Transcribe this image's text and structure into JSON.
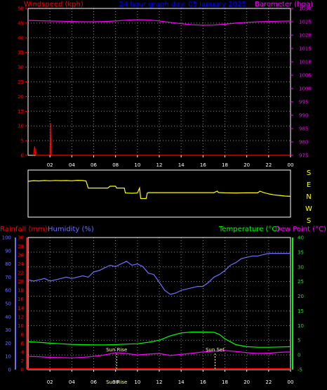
{
  "header": {
    "left_label": "Windspeed (kph)",
    "center_label": "24 hour graph day: 05 January 2025",
    "right_label": "Barometer (hpa)"
  },
  "colors": {
    "wind": "#ff0000",
    "barometer": "#ff00ff",
    "header_center": "#0000ff",
    "direction": "#ffff00",
    "rain": "#ff0000",
    "humidity": "#6f6fff",
    "temperature": "#00ff00",
    "dewpoint": "#ff00ff",
    "grid": "#8a8a8a",
    "axis_text": "#ffffff",
    "sun": "#ffffaa"
  },
  "time_ticks": [
    "02",
    "04",
    "06",
    "08",
    "10",
    "12",
    "14",
    "16",
    "18",
    "20",
    "22",
    "00"
  ],
  "direction_labels": [
    "S",
    "E",
    "N",
    "W",
    "S"
  ],
  "bottom_header": {
    "rainfall_label": "Rainfall (mm)",
    "humidity_label": "Humidity (%)",
    "temperature_label": "Temperature (°C)",
    "dewpoint_label": "Dew Point (°C)"
  },
  "sun_events": {
    "sunrise_label": "Sun Rise",
    "sunset_label": "Sun Set",
    "sun_bottom_label": "Sun Rise",
    "sunrise_hour": 8.1,
    "sunset_hour": 17.1
  },
  "chart_data": [
    {
      "type": "line",
      "title": "24 hour graph day: 05 January 2025",
      "x_range_hours": [
        0,
        24
      ],
      "left_axis": {
        "label": "Windspeed (kph)",
        "range": [
          0,
          50
        ],
        "ticks": [
          0,
          5,
          10,
          15,
          20,
          25,
          30,
          35,
          40,
          45,
          50
        ]
      },
      "right_axis": {
        "label": "Barometer (hpa)",
        "range": [
          975,
          1030
        ],
        "ticks": [
          975,
          980,
          985,
          990,
          995,
          1000,
          1005,
          1010,
          1015,
          1020,
          1025,
          1030
        ]
      },
      "grid": true,
      "series": [
        {
          "name": "Windspeed",
          "axis": "left",
          "x": [
            0.5,
            0.6,
            0.7,
            2.0,
            2.05,
            2.1,
            3.0,
            12.0,
            24.0
          ],
          "y": [
            0,
            3,
            0,
            0,
            11,
            0,
            0,
            0,
            0
          ]
        },
        {
          "name": "Barometer",
          "axis": "right",
          "x": [
            0,
            1,
            2,
            3,
            4,
            5,
            6,
            7,
            8,
            9,
            10,
            11,
            12,
            13,
            14,
            15,
            16,
            17,
            18,
            19,
            20,
            21,
            22,
            23,
            24
          ],
          "y": [
            1025.5,
            1025.4,
            1025.3,
            1025.2,
            1025.1,
            1025.0,
            1025.0,
            1025.1,
            1025.3,
            1025.6,
            1025.8,
            1025.7,
            1025.3,
            1024.8,
            1024.3,
            1023.9,
            1023.7,
            1023.8,
            1024.1,
            1024.5,
            1024.8,
            1025.0,
            1025.1,
            1025.2,
            1025.3
          ]
        }
      ]
    },
    {
      "type": "line",
      "x_range_hours": [
        0,
        24
      ],
      "direction_axis": [
        "S",
        "E",
        "N",
        "W",
        "S"
      ],
      "series": [
        {
          "name": "Wind direction",
          "unit": "degrees",
          "x": [
            0,
            0.5,
            1,
            1.5,
            2,
            2.5,
            3,
            3.5,
            4,
            4.5,
            5,
            5.3,
            5.5,
            6,
            7,
            7.3,
            7.5,
            8.0,
            8.1,
            8.5,
            8.8,
            8.9,
            9.5,
            10,
            10.2,
            10.3,
            10.8,
            10.9,
            11,
            12,
            13,
            14,
            15,
            16,
            17,
            17.3,
            17.4,
            17.5,
            17.6,
            18,
            19,
            20,
            21,
            21.2,
            21.5,
            22,
            22.5,
            23,
            23.5,
            24
          ],
          "y": [
            280,
            285,
            283,
            286,
            284,
            287,
            285,
            286,
            284,
            288,
            286,
            283,
            225,
            225,
            225,
            225,
            240,
            240,
            225,
            225,
            225,
            185,
            183,
            185,
            225,
            140,
            140,
            185,
            188,
            188,
            188,
            188,
            188,
            188,
            188,
            200,
            190,
            188,
            188,
            186,
            185,
            187,
            186,
            200,
            190,
            178,
            170,
            165,
            160,
            158
          ]
        }
      ]
    },
    {
      "type": "line",
      "x_range_hours": [
        0,
        24
      ],
      "left_axes": [
        {
          "label": "Rainfall (mm)",
          "range": [
            0,
            30
          ],
          "ticks": [
            0,
            2,
            4,
            6,
            8,
            10,
            12,
            14,
            16,
            18,
            20,
            22,
            24,
            26,
            28,
            30
          ]
        },
        {
          "label": "Humidity (%)",
          "range": [
            0,
            100
          ],
          "ticks": [
            0,
            10,
            20,
            30,
            40,
            50,
            60,
            70,
            80,
            90,
            100
          ]
        }
      ],
      "right_axis": {
        "label": "Temperature (°C) / Dew Point (°C)",
        "range": [
          -5,
          40
        ],
        "ticks": [
          -5,
          0,
          5,
          10,
          15,
          20,
          25,
          30,
          35,
          40
        ]
      },
      "grid": true,
      "series": [
        {
          "name": "Rainfall",
          "axis": "rain",
          "x": [
            0,
            24
          ],
          "y": [
            0,
            0
          ]
        },
        {
          "name": "Humidity",
          "axis": "humidity",
          "x": [
            0,
            0.5,
            1,
            1.5,
            2,
            2.5,
            3,
            3.5,
            4,
            4.5,
            5,
            5.5,
            6,
            6.5,
            7,
            7.5,
            8,
            8.5,
            9,
            9.5,
            10,
            10.5,
            11,
            11.5,
            12,
            12.5,
            13,
            13.5,
            14,
            14.5,
            15,
            15.5,
            16,
            16.5,
            17,
            17.5,
            18,
            18.5,
            19,
            19.5,
            20,
            20.5,
            21,
            21.5,
            22,
            22.5,
            23,
            23.5,
            24
          ],
          "y": [
            68,
            67,
            68,
            69,
            67,
            68,
            69,
            70,
            69,
            70,
            71,
            70,
            74,
            75,
            77,
            79,
            78,
            80,
            82,
            79,
            80,
            78,
            73,
            72,
            66,
            60,
            57,
            58,
            60,
            61,
            62,
            63,
            63,
            66,
            70,
            72,
            75,
            79,
            81,
            84,
            85,
            86,
            86,
            87,
            88,
            88,
            88,
            88,
            88
          ]
        },
        {
          "name": "Temperature",
          "axis": "temp",
          "x": [
            0,
            1,
            2,
            3,
            4,
            5,
            6,
            7,
            8,
            9,
            10,
            11,
            12,
            13,
            14,
            15,
            16,
            17,
            17.5,
            18,
            18.5,
            19,
            20,
            21,
            22,
            23,
            24
          ],
          "y": [
            4.5,
            4.3,
            4.0,
            3.8,
            3.6,
            3.5,
            3.4,
            3.4,
            3.5,
            3.7,
            3.8,
            4.3,
            5.0,
            6.5,
            7.5,
            7.8,
            7.8,
            7.7,
            7.0,
            5.5,
            4.5,
            3.5,
            2.8,
            2.6,
            2.6,
            2.7,
            2.8
          ]
        },
        {
          "name": "Dew Point",
          "axis": "temp",
          "x": [
            0,
            1,
            2,
            3,
            4,
            5,
            6,
            7,
            8,
            9,
            10,
            11,
            12,
            13,
            14,
            15,
            16,
            17,
            18,
            19,
            20,
            21,
            22,
            23,
            24
          ],
          "y": [
            -0.5,
            -0.6,
            -0.8,
            -0.9,
            -1.0,
            -0.8,
            -0.5,
            0.0,
            0.8,
            0.5,
            0.0,
            0.3,
            0.5,
            -0.2,
            0.2,
            0.6,
            1.0,
            1.3,
            1.5,
            1.2,
            0.8,
            0.5,
            0.6,
            0.9,
            1.0
          ]
        }
      ]
    }
  ]
}
